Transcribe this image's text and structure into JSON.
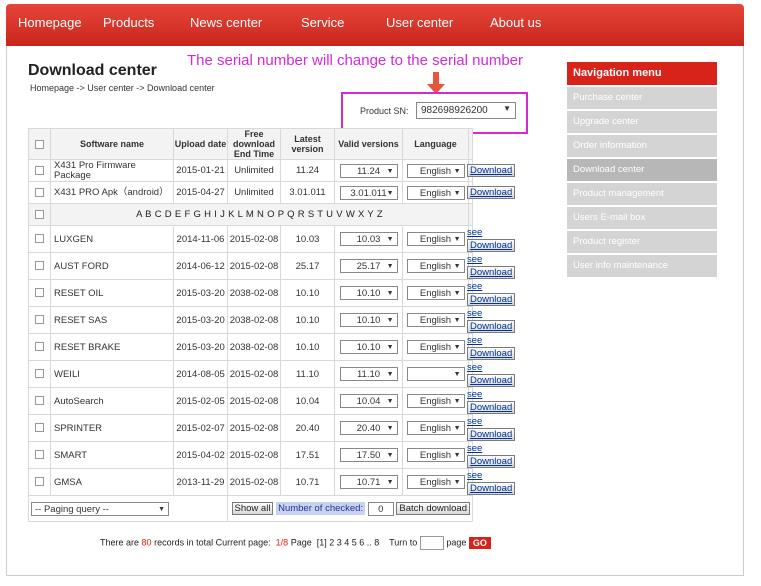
{
  "nav": [
    "Homepage",
    "Products",
    "News center",
    "Service",
    "User center",
    "About us"
  ],
  "page_title": "Download center",
  "breadcrumb": "Homepage -> User center -> Download center",
  "annotation": "The serial number will change to the serial number",
  "product_sn_label": "Product SN:",
  "product_sn_value": "982698926200",
  "table": {
    "headers": [
      "Software name",
      "Upload date",
      "Free download End Time",
      "Latest version",
      "Valid versions",
      "Language"
    ],
    "top_rows": [
      {
        "name": "X431 Pro Firmware Package",
        "upload": "2015-01-21",
        "end": "Unlimited",
        "latest": "11.24",
        "valid": "11.24",
        "lang": "English",
        "action": "Download"
      },
      {
        "name": "X431 PRO Apk（android）",
        "upload": "2015-04-27",
        "end": "Unlimited",
        "latest": "3.01.011",
        "valid": "3.01.011",
        "lang": "English",
        "action": "Download"
      }
    ],
    "alphabet": "A B C D E F G H I J K L M N O P Q R S T U V W X Y Z",
    "rows": [
      {
        "name": "LUXGEN",
        "upload": "2014-11-06",
        "end": "2015-02-08",
        "latest": "10.03",
        "valid": "10.03",
        "lang": "English"
      },
      {
        "name": "AUST FORD",
        "upload": "2014-06-12",
        "end": "2015-02-08",
        "latest": "25.17",
        "valid": "25.17",
        "lang": "English"
      },
      {
        "name": "RESET OIL",
        "upload": "2015-03-20",
        "end": "2038-02-08",
        "latest": "10.10",
        "valid": "10.10",
        "lang": "English"
      },
      {
        "name": "RESET SAS",
        "upload": "2015-03-20",
        "end": "2038-02-08",
        "latest": "10.10",
        "valid": "10.10",
        "lang": "English"
      },
      {
        "name": "RESET BRAKE",
        "upload": "2015-03-20",
        "end": "2038-02-08",
        "latest": "10.10",
        "valid": "10.10",
        "lang": "English"
      },
      {
        "name": "WEILI",
        "upload": "2014-08-05",
        "end": "2015-02-08",
        "latest": "11.10",
        "valid": "11.10",
        "lang": ""
      },
      {
        "name": "AutoSearch",
        "upload": "2015-02-05",
        "end": "2015-02-08",
        "latest": "10.04",
        "valid": "10.04",
        "lang": "English"
      },
      {
        "name": "SPRINTER",
        "upload": "2015-02-07",
        "end": "2015-02-08",
        "latest": "20.40",
        "valid": "20.40",
        "lang": "English"
      },
      {
        "name": "SMART",
        "upload": "2015-04-02",
        "end": "2015-02-08",
        "latest": "17.51",
        "valid": "17.50",
        "lang": "English"
      },
      {
        "name": "GMSA",
        "upload": "2013-11-29",
        "end": "2015-02-08",
        "latest": "10.71",
        "valid": "10.71",
        "lang": "English"
      }
    ],
    "see_label": "see",
    "download_label": "Download"
  },
  "footer": {
    "paging_query": "-- Paging query --",
    "show_all": "Show all",
    "number_checked": "Number of checked:",
    "checked_count": "0",
    "batch_download": "Batch download"
  },
  "pager": {
    "prefix": "There are",
    "count": "80",
    "middle": "records in total Current page:",
    "page": "1/8",
    "page_word": "Page",
    "links": "[1] 2 3 4 5 6 .. 8",
    "turn_to": "Turn to",
    "page_suffix": "page",
    "go": "GO"
  },
  "side_menu": {
    "title": "Navigation menu",
    "items": [
      "Purchase center",
      "Upgrade center",
      "Order information",
      "Download center",
      "Product management",
      "Users E-mail box",
      "Product register",
      "User info maintenance"
    ],
    "active": "Download center"
  },
  "colors": {
    "brand_red": "#d8231b",
    "annotation": "#d32bd3"
  }
}
